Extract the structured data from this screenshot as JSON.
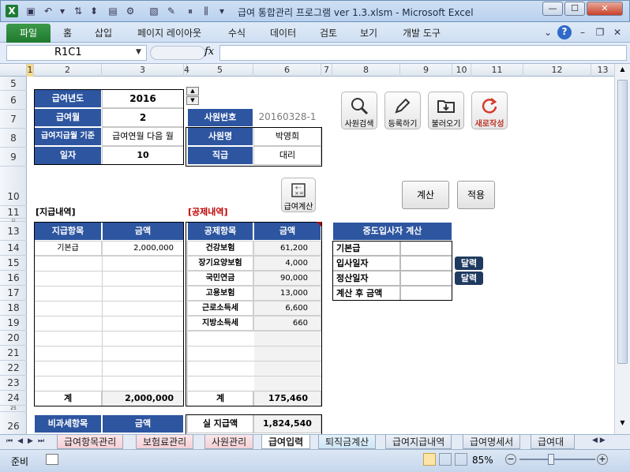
{
  "window": {
    "title": "급여 통합관리 프로그램 ver 1.3.xlsm  -  Microsoft Excel"
  },
  "ribbon": {
    "file_tab": "파일",
    "tabs": [
      "홈",
      "삽입",
      "페이지 레이아웃",
      "수식",
      "데이터",
      "검토",
      "보기",
      "개발 도구"
    ]
  },
  "formula_bar": {
    "name_box": "R1C1",
    "fx": "fx",
    "formula": ""
  },
  "columns": [
    "1",
    "2",
    "3",
    "4",
    "5",
    "6",
    "7",
    "8",
    "9",
    "10",
    "11",
    "12",
    "13"
  ],
  "rows": [
    "5",
    "6",
    "7",
    "8",
    "9",
    "10",
    "11",
    "12",
    "13",
    "14",
    "15",
    "16",
    "17",
    "18",
    "19",
    "20",
    "21",
    "22",
    "23",
    "24",
    "25",
    "26"
  ],
  "pay_info": [
    {
      "label": "급여년도",
      "value": "2016"
    },
    {
      "label": "급여월",
      "value": "2"
    },
    {
      "label": "급여지급월 기준",
      "value": "급여연월 다음 월"
    },
    {
      "label": "일자",
      "value": "10"
    }
  ],
  "employee": {
    "id_label": "사원번호",
    "id_value": "20160328-1",
    "name_label": "사원명",
    "name_value": "박영희",
    "rank_label": "직급",
    "rank_value": "대리"
  },
  "buttons": {
    "search": "사원검색",
    "register": "등록하기",
    "load": "불러오기",
    "new": "새로작성",
    "calc_pay": "급여계산",
    "calculate": "계산",
    "apply": "적용",
    "calendar": "달력"
  },
  "payments": {
    "section_title": "[지급내역]",
    "header_item": "지급항목",
    "header_amount": "금액",
    "items": [
      {
        "name": "기본급",
        "amount": "2,000,000"
      }
    ],
    "total_label": "계",
    "total_amount": "2,000,000"
  },
  "deductions": {
    "section_title": "[공제내역]",
    "header_item": "공제항목",
    "header_amount": "금액",
    "items": [
      {
        "name": "건강보험",
        "amount": "61,200"
      },
      {
        "name": "장기요양보험",
        "amount": "4,000"
      },
      {
        "name": "국민연금",
        "amount": "90,000"
      },
      {
        "name": "고용보험",
        "amount": "13,000"
      },
      {
        "name": "근로소득세",
        "amount": "6,600"
      },
      {
        "name": "지방소득세",
        "amount": "660"
      }
    ],
    "total_label": "계",
    "total_amount": "175,460"
  },
  "midterm": {
    "title": "중도입사자 계산",
    "rows": [
      "기본급",
      "입사일자",
      "정산일자",
      "계산 후 금액"
    ]
  },
  "nontax": {
    "header_item": "비과세항목",
    "header_amount": "금액"
  },
  "net_pay": {
    "label": "실 지급액",
    "value": "1,824,540"
  },
  "sheet_tabs": [
    "급여항목관리",
    "보험료관리",
    "사원관리",
    "급여입력",
    "퇴직금계산",
    "급여지급내역",
    "급여명세서",
    "급여대"
  ],
  "status": {
    "ready": "준비",
    "zoom": "85%"
  },
  "colors": {
    "header_blue": "#2d55a0",
    "file_green": "#1f7a2e",
    "calendar_btn": "#1f3a5f",
    "deduction_title": "#c00000"
  }
}
